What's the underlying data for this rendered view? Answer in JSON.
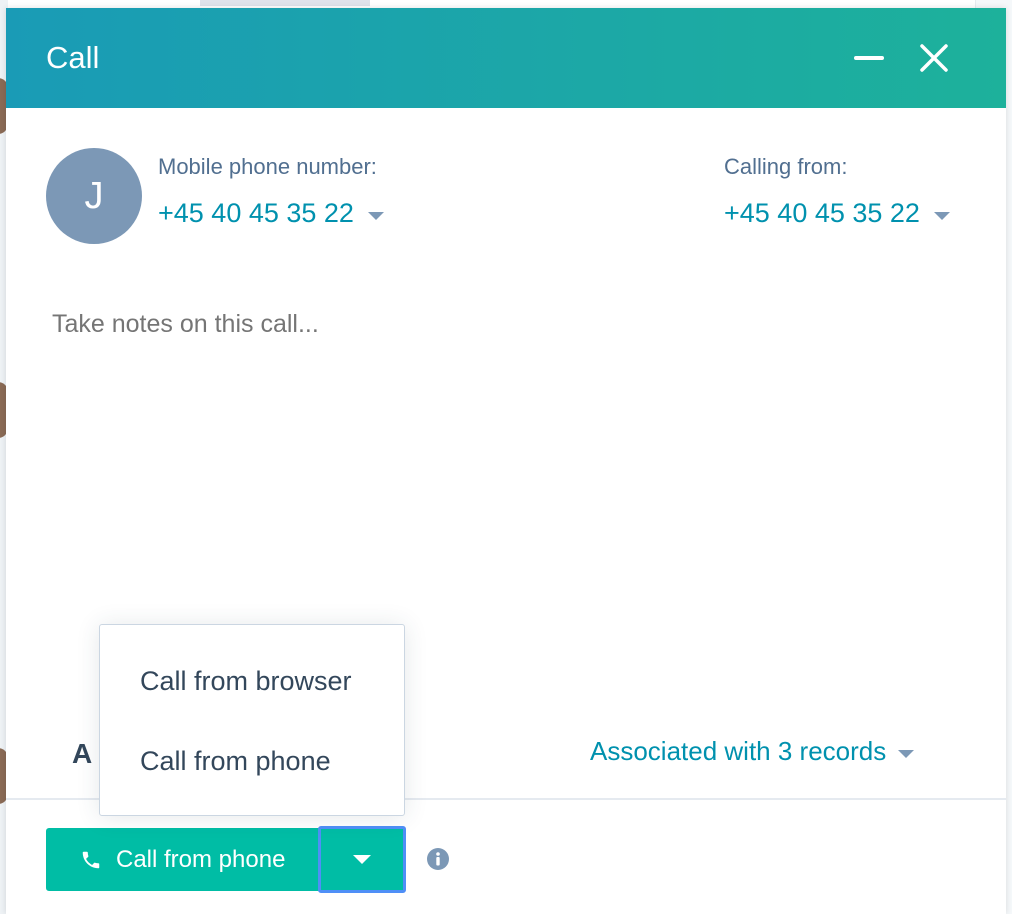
{
  "modal": {
    "title": "Call"
  },
  "contact": {
    "avatar_initial": "J",
    "to_label": "Mobile phone number:",
    "to_number": "+45 40 45 35 22",
    "from_label": "Calling from:",
    "from_number": "+45 40 45 35 22"
  },
  "notes": {
    "placeholder": "Take notes on this call..."
  },
  "associations": {
    "partial_label": "A",
    "link_label": "Associated with 3 records"
  },
  "call_button": {
    "label": "Call from phone"
  },
  "dropdown": {
    "items": [
      {
        "label": "Call from browser"
      },
      {
        "label": "Call from phone"
      }
    ]
  },
  "icons": {
    "minimize": "minimize-icon",
    "close": "close-icon",
    "phone": "phone-icon",
    "info": "info-icon",
    "caret": "chevron-down-icon"
  },
  "colors": {
    "header_start": "#1a9bb6",
    "header_end": "#1db19b",
    "accent": "#0091ae",
    "button": "#00bda5",
    "focus_ring": "#4f8ff7",
    "avatar": "#7c98b6"
  }
}
